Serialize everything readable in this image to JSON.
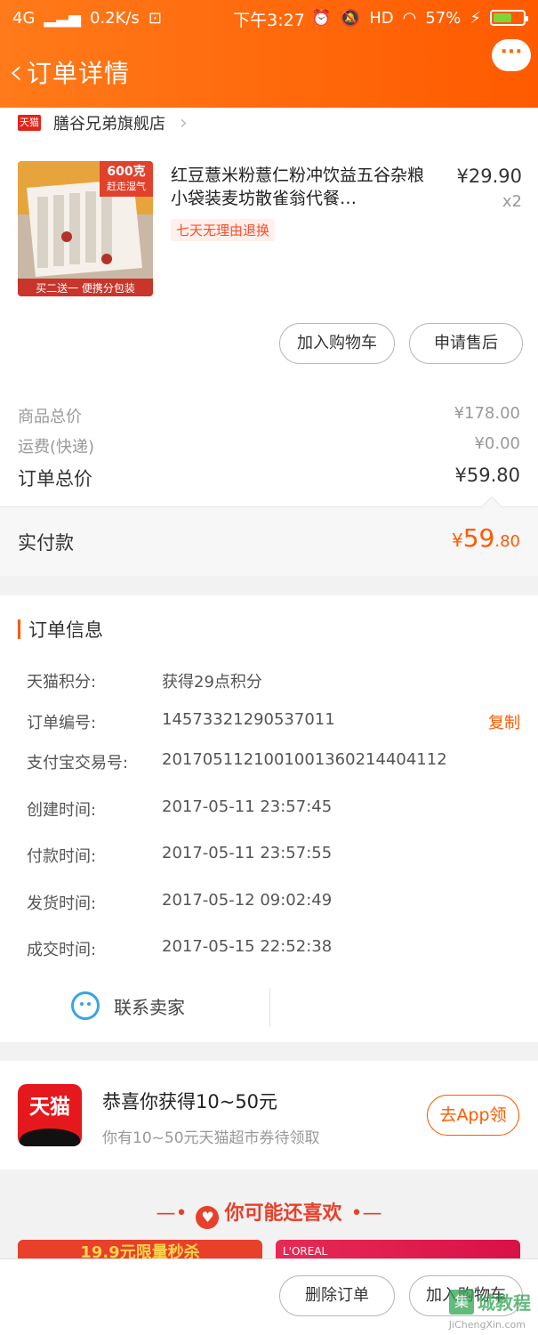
{
  "status_bar": {
    "network": "4G",
    "speed": "0.2K/s",
    "time": "下午3:27",
    "hd": "HD",
    "battery": "57%"
  },
  "header": {
    "title": "订单详情",
    "more": "···"
  },
  "shop": {
    "badge": "天猫",
    "name": "膳谷兄弟旗舰店"
  },
  "product": {
    "title": "红豆薏米粉薏仁粉冲饮益五谷杂粮小袋装麦坊散雀翁代餐…",
    "price": "¥29.90",
    "qty": "x2",
    "tag": "七天无理由退换",
    "image_badge": "600克",
    "image_badge2": "赶走湿气",
    "image_banner": "买二送一 便携分包装"
  },
  "actions": {
    "add_cart": "加入购物车",
    "after_sale": "申请售后"
  },
  "summary": {
    "goods_label": "商品总价",
    "goods_value": "¥178.00",
    "shipping_label": "运费(快递)",
    "shipping_value": "¥0.00",
    "total_label": "订单总价",
    "total_value": "¥59.80"
  },
  "payment": {
    "label": "实付款",
    "currency": "¥",
    "int": "59",
    "dec": ".80"
  },
  "order_info": {
    "title": "订单信息",
    "rows": [
      {
        "label": "天猫积分:",
        "value": "获得29点积分"
      },
      {
        "label": "订单编号:",
        "value": "1457332129053701​1"
      },
      {
        "label": "支付宝交易号:",
        "value": "2017051121001001360214404112"
      },
      {
        "label": "创建时间:",
        "value": "2017-05-11 23:57:45"
      },
      {
        "label": "付款时间:",
        "value": "2017-05-11 23:57:55"
      },
      {
        "label": "发货时间:",
        "value": "2017-05-12 09:02:49"
      },
      {
        "label": "成交时间:",
        "value": "2017-05-15 22:52:38"
      }
    ],
    "copy": "复制"
  },
  "contact": {
    "label": "联系卖家"
  },
  "promo": {
    "logo": "天猫",
    "title": "恭喜你获得10~50元",
    "sub": "你有10~50元天猫超市券待领取",
    "button": "去App领"
  },
  "recommend": {
    "title": "你可能还喜欢",
    "card_left": "19.9元限量秒杀",
    "card_right": "L'OREAL"
  },
  "bottom": {
    "delete": "删除订单",
    "add_cart": "加入购物车"
  },
  "watermark": {
    "box": "集",
    "text": "城教程",
    "url": "JiChengXin.com"
  },
  "colors": {
    "accent": "#ff5a00",
    "tmall_red": "#e5191d",
    "contact_blue": "#3aa3e3"
  }
}
